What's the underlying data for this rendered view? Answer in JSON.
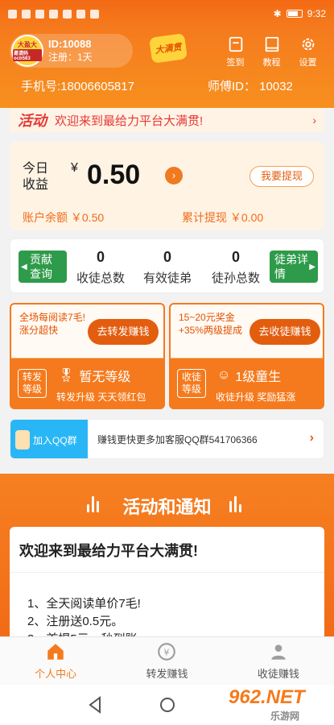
{
  "statusbar": {
    "time": "9:32"
  },
  "header": {
    "avatar_line1": "大盈大",
    "avatar_line2": "邀请码ocb583",
    "user_id": "ID:10088",
    "registered": "注册：1天",
    "logo_text": "大满贯",
    "buttons": [
      {
        "label": "签到"
      },
      {
        "label": "教程"
      },
      {
        "label": "设置"
      }
    ],
    "phone": "手机号:18006605817",
    "master": "师傅ID：  10032"
  },
  "banner": {
    "tag": "活动",
    "text": "欢迎来到最给力平台大满贯!",
    "arrow": "›"
  },
  "earnings": {
    "label": "今日收益",
    "currency": "¥",
    "value": "0.50",
    "go": "›",
    "withdraw_label": "我要提现",
    "balance": "账户余额 ￥0.50",
    "total_withdraw": "累计提现 ￥0.00"
  },
  "stats": {
    "left_button": "贡献查询",
    "right_button": "徒弟详情",
    "items": [
      {
        "value": "0",
        "label": "收徒总数"
      },
      {
        "value": "0",
        "label": "有效徒弟"
      },
      {
        "value": "0",
        "label": "徒孙总数"
      }
    ]
  },
  "promos": [
    {
      "text": "全场每阅读7毛! 涨分超快",
      "button": "去转发赚钱",
      "badge": "转发等级",
      "level": "暂无等级",
      "desc": "转发升级 天天领红包"
    },
    {
      "text": "15~20元奖金+35%两级提成",
      "button": "去收徒赚钱",
      "badge": "收徒等级",
      "level": "1级童生",
      "desc": "收徒升级 奖励猛涨"
    }
  ],
  "qq": {
    "tag": "加入QQ群",
    "text": "赚钱更快更多加客服QQ群541706366",
    "arrow": "›"
  },
  "notices": {
    "section_title": "活动和通知",
    "card_title": "欢迎来到最给力平台大满贯!",
    "lines": [
      "1、全天阅读单价7毛!",
      "2、注册送0.5元。",
      "3、首提5元，秒到账"
    ]
  },
  "tabs": [
    {
      "label": "个人中心",
      "active": true
    },
    {
      "label": "转发赚钱",
      "active": false
    },
    {
      "label": "收徒赚钱",
      "active": false
    }
  ],
  "watermark": {
    "brand": "962.NET",
    "sub": "乐游网"
  },
  "colors": {
    "brand": "#f57a1d",
    "accent": "#e35d0f",
    "green": "#2e9b4a",
    "qq": "#29b6f6"
  }
}
